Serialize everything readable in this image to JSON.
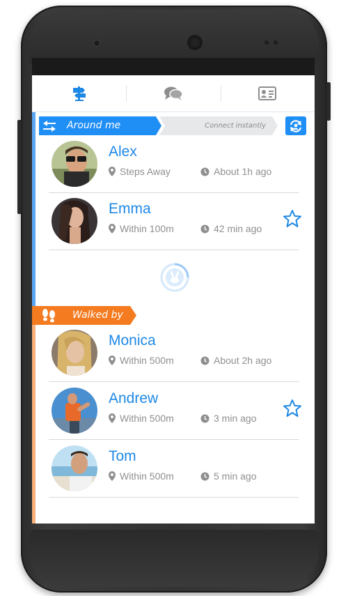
{
  "tabs": [
    {
      "name": "signpost-icon",
      "active": true
    },
    {
      "name": "chat-icon",
      "active": false
    },
    {
      "name": "contact-card-icon",
      "active": false
    }
  ],
  "around": {
    "label": "Around me",
    "connect_label": "Connect instantly",
    "people": [
      {
        "name": "Alex",
        "location": "Steps Away",
        "time": "About 1h ago",
        "favorite": false
      },
      {
        "name": "Emma",
        "location": "Within 100m",
        "time": "42 min ago",
        "favorite": true
      }
    ]
  },
  "walked": {
    "label": "Walked by",
    "people": [
      {
        "name": "Monica",
        "location": "Within 500m",
        "time": "About 2h ago",
        "favorite": false
      },
      {
        "name": "Andrew",
        "location": "Within 500m",
        "time": "3 min ago",
        "favorite": true
      },
      {
        "name": "Tom",
        "location": "Within 500m",
        "time": "5 min ago",
        "favorite": false
      }
    ]
  },
  "colors": {
    "accent_blue": "#1f8ef5",
    "name_blue": "#1e88e5",
    "walked_orange": "#f47b20",
    "meta_gray": "#8f8f8f"
  }
}
